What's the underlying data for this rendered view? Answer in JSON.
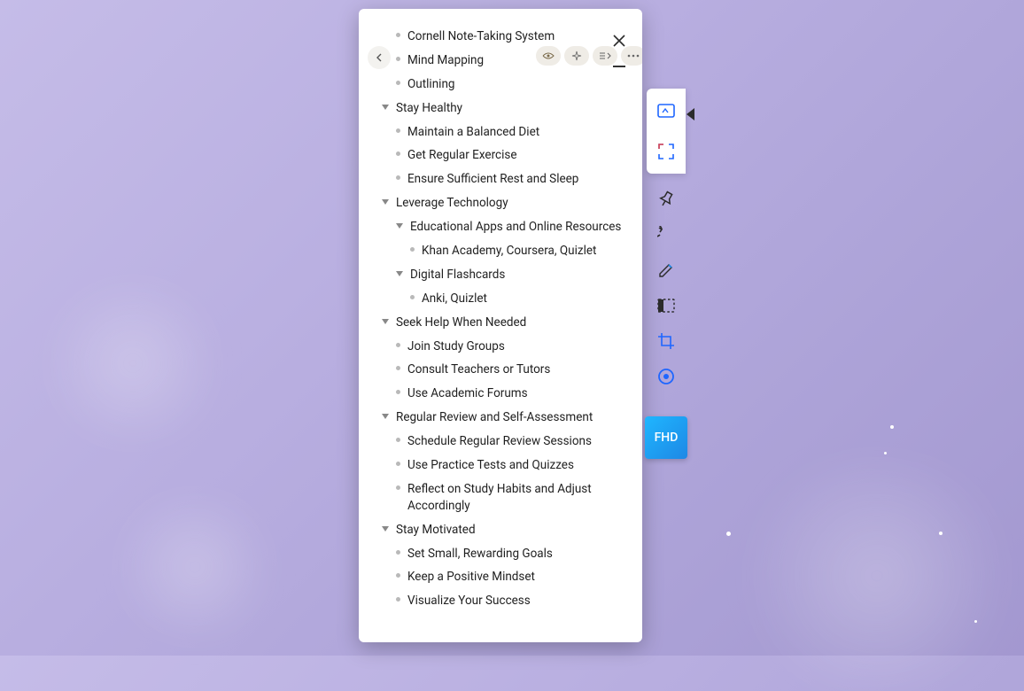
{
  "outline": {
    "items": [
      {
        "level": 1,
        "type": "bullet",
        "text": "Cornell Note-Taking System"
      },
      {
        "level": 1,
        "type": "bullet",
        "text": "Mind Mapping"
      },
      {
        "level": 1,
        "type": "bullet",
        "text": "Outlining"
      },
      {
        "level": 0,
        "type": "triangle",
        "text": "Stay Healthy"
      },
      {
        "level": 1,
        "type": "bullet",
        "text": "Maintain a Balanced Diet"
      },
      {
        "level": 1,
        "type": "bullet",
        "text": "Get Regular Exercise"
      },
      {
        "level": 1,
        "type": "bullet",
        "text": "Ensure Sufficient Rest and Sleep"
      },
      {
        "level": 0,
        "type": "triangle",
        "text": "Leverage Technology"
      },
      {
        "level": 1,
        "type": "triangle",
        "text": "Educational Apps and Online Resources"
      },
      {
        "level": 2,
        "type": "bullet",
        "text": "Khan Academy, Coursera, Quizlet"
      },
      {
        "level": 1,
        "type": "triangle",
        "text": "Digital Flashcards"
      },
      {
        "level": 2,
        "type": "bullet",
        "text": "Anki, Quizlet"
      },
      {
        "level": 0,
        "type": "triangle",
        "text": "Seek Help When Needed"
      },
      {
        "level": 1,
        "type": "bullet",
        "text": "Join Study Groups"
      },
      {
        "level": 1,
        "type": "bullet",
        "text": "Consult Teachers or Tutors"
      },
      {
        "level": 1,
        "type": "bullet",
        "text": "Use Academic Forums"
      },
      {
        "level": 0,
        "type": "triangle",
        "text": "Regular Review and Self-Assessment"
      },
      {
        "level": 1,
        "type": "bullet",
        "text": "Schedule Regular Review Sessions"
      },
      {
        "level": 1,
        "type": "bullet",
        "text": "Use Practice Tests and Quizzes"
      },
      {
        "level": 1,
        "type": "bullet",
        "text": "Reflect on Study Habits and Adjust Accordingly"
      },
      {
        "level": 0,
        "type": "triangle",
        "text": "Stay Motivated"
      },
      {
        "level": 1,
        "type": "bullet",
        "text": "Set Small, Rewarding Goals"
      },
      {
        "level": 1,
        "type": "bullet",
        "text": "Keep a Positive Mindset"
      },
      {
        "level": 1,
        "type": "bullet",
        "text": "Visualize Your Success"
      }
    ]
  },
  "side_toolbar": {
    "badge_label": "FHD"
  }
}
